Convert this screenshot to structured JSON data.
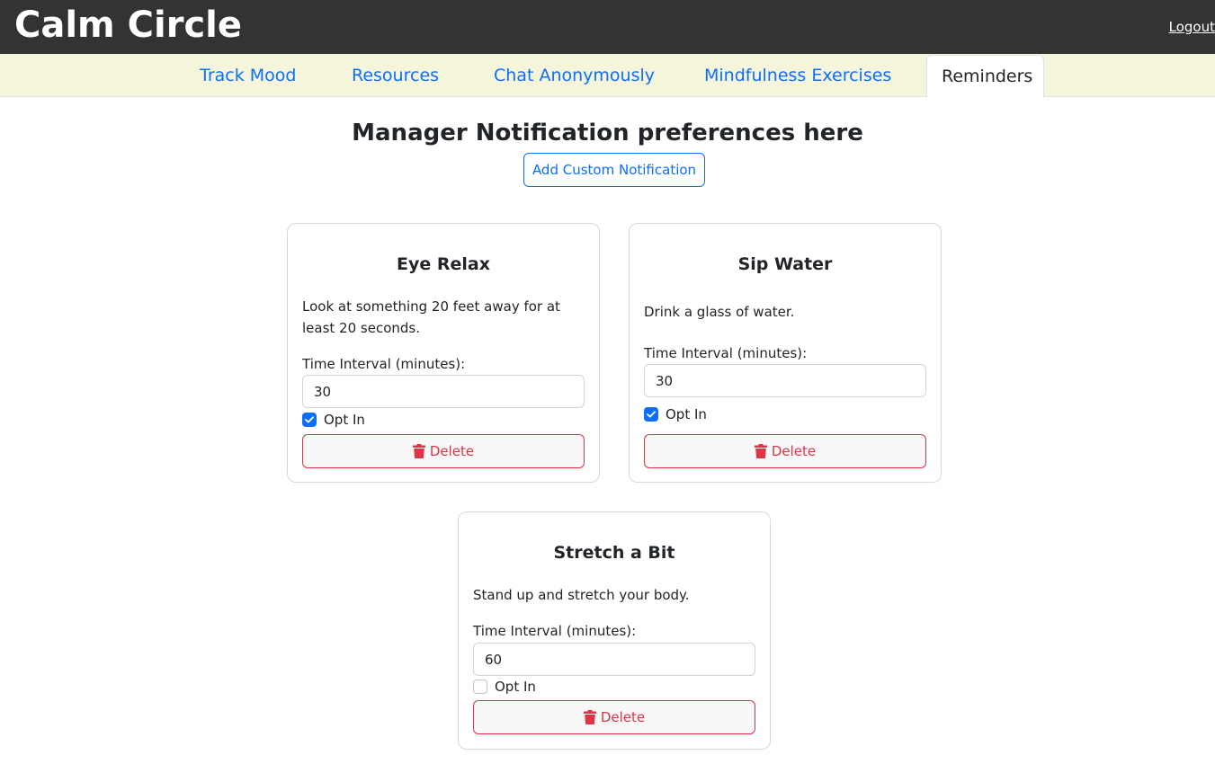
{
  "header": {
    "brand": "Calm Circle",
    "logout": "Logout"
  },
  "nav": {
    "tabs": [
      {
        "label": "Track Mood",
        "active": false
      },
      {
        "label": "Resources",
        "active": false
      },
      {
        "label": "Chat Anonymously",
        "active": false
      },
      {
        "label": "Mindfulness Exercises",
        "active": false
      },
      {
        "label": "Reminders",
        "active": true
      }
    ]
  },
  "main": {
    "title": "Manager Notification preferences here",
    "add_button": "Add Custom Notification"
  },
  "cards": [
    {
      "title": "Eye Relax",
      "description": "Look at something 20 feet away for at least 20 seconds.",
      "interval_label": "Time Interval (minutes):",
      "interval_value": "30",
      "opt_in_label": "Opt In",
      "opt_in": true,
      "delete_label": "Delete"
    },
    {
      "title": "Sip Water",
      "description": "Drink a glass of water.",
      "interval_label": "Time Interval (minutes):",
      "interval_value": "30",
      "opt_in_label": "Opt In",
      "opt_in": true,
      "delete_label": "Delete"
    },
    {
      "title": "Stretch a Bit",
      "description": "Stand up and stretch your body.",
      "interval_label": "Time Interval (minutes):",
      "interval_value": "60",
      "opt_in_label": "Opt In",
      "opt_in": false,
      "delete_label": "Delete"
    }
  ],
  "colors": {
    "primary": "#0d6efd",
    "danger": "#dc3545",
    "header_bg": "#333333",
    "nav_bg": "#f5f5dc"
  },
  "icons": {
    "delete": "trash-icon",
    "check": "checkmark-icon"
  }
}
